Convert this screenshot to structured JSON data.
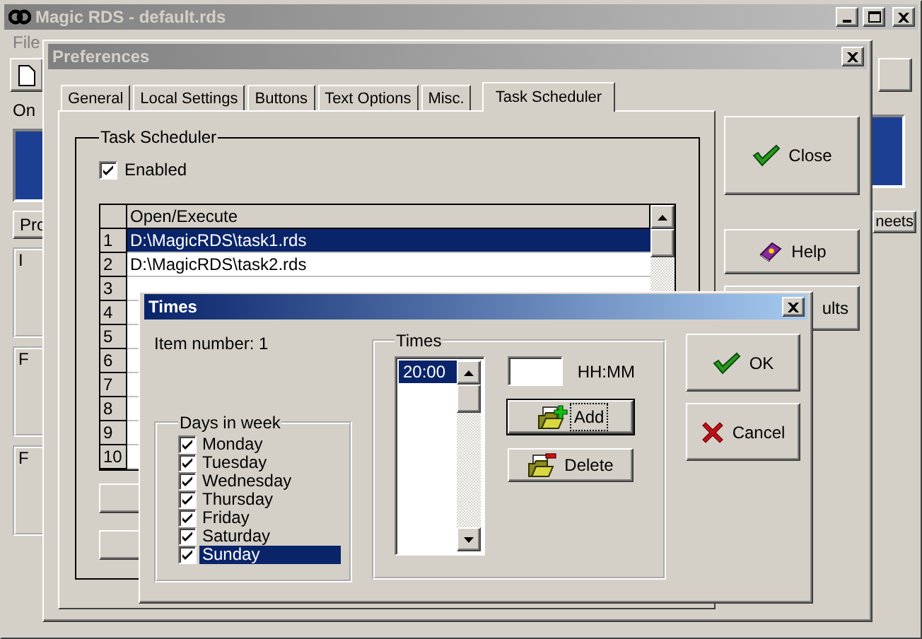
{
  "main_window": {
    "title": "Magic RDS - default.rds",
    "active": false,
    "menu": [
      "File"
    ],
    "group_label": "On",
    "left_tab": "Pro",
    "left_group_labels": [
      "I",
      "F",
      "F"
    ],
    "right_tab": "neets"
  },
  "preferences": {
    "title": "Preferences",
    "active": false,
    "tabs": [
      {
        "label": "General",
        "selected": false
      },
      {
        "label": "Local Settings",
        "selected": false
      },
      {
        "label": "Buttons",
        "selected": false
      },
      {
        "label": "Text Options",
        "selected": false
      },
      {
        "label": "Misc.",
        "selected": false
      },
      {
        "label": "Task Scheduler",
        "selected": true
      }
    ],
    "group_title": "Task Scheduler",
    "enabled": {
      "label": "Enabled",
      "checked": true
    },
    "table": {
      "columns": [
        "Open/Execute"
      ],
      "rows": [
        {
          "number": "1",
          "path": "D:\\MagicRDS\\task1.rds",
          "selected": true
        },
        {
          "number": "2",
          "path": "D:\\MagicRDS\\task2.rds",
          "selected": false
        },
        {
          "number": "3",
          "selected": false
        },
        {
          "number": "4",
          "selected": false
        },
        {
          "number": "5",
          "selected": false
        },
        {
          "number": "6",
          "selected": false
        },
        {
          "number": "7",
          "selected": false
        },
        {
          "number": "8",
          "selected": false
        },
        {
          "number": "9",
          "selected": false
        },
        {
          "number": "10",
          "selected": false
        }
      ]
    },
    "buttons": [
      {
        "kind": "close",
        "label": "Close"
      },
      {
        "kind": "help",
        "label": "Help"
      },
      {
        "kind": "defaults",
        "label": "ults"
      }
    ]
  },
  "times_dialog": {
    "title": "Times",
    "active": true,
    "item_number": "Item number: 1",
    "days_group": "Days in week",
    "days": [
      {
        "label": "Monday",
        "checked": true,
        "selected": false
      },
      {
        "label": "Tuesday",
        "checked": true,
        "selected": false
      },
      {
        "label": "Wednesday",
        "checked": true,
        "selected": false
      },
      {
        "label": "Thursday",
        "checked": true,
        "selected": false
      },
      {
        "label": "Friday",
        "checked": true,
        "selected": false
      },
      {
        "label": "Saturday",
        "checked": true,
        "selected": false
      },
      {
        "label": "Sunday",
        "checked": true,
        "selected": true
      }
    ],
    "times_group": "Times",
    "times": [
      {
        "label": "20:00",
        "selected": true
      }
    ],
    "time_field": {
      "label": "HH:MM"
    },
    "list_buttons": [
      {
        "kind": "add",
        "label": "Add",
        "focused": true
      },
      {
        "kind": "delete",
        "label": "Delete",
        "focused": false
      }
    ],
    "buttons": [
      {
        "kind": "ok",
        "label": "OK"
      },
      {
        "kind": "cancel",
        "label": "Cancel"
      }
    ]
  }
}
